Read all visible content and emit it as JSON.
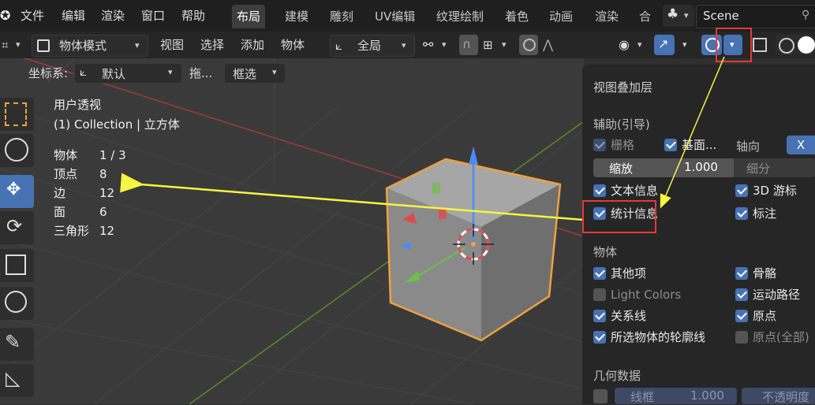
{
  "topbar": {
    "menus": [
      "文件",
      "编辑",
      "渲染",
      "窗口",
      "帮助"
    ],
    "tabs": [
      "布局",
      "建模",
      "雕刻",
      "UV编辑",
      "纹理绘制",
      "着色",
      "动画",
      "渲染",
      "合"
    ],
    "active_tab": "布局",
    "scene": "Scene"
  },
  "header": {
    "mode": "物体模式",
    "menus": [
      "视图",
      "选择",
      "添加",
      "物体"
    ],
    "transform_orientation": "全局",
    "coord_label": "坐标系:",
    "coord_value": "默认",
    "drag_label": "拖...",
    "select_mode": "框选"
  },
  "viewport": {
    "view_name": "用户透视",
    "collection": "(1) Collection | 立方体",
    "stats": [
      {
        "label": "物体",
        "value": "1 / 3"
      },
      {
        "label": "顶点",
        "value": "8"
      },
      {
        "label": "边",
        "value": "12"
      },
      {
        "label": "面",
        "value": "6"
      },
      {
        "label": "三角形",
        "value": "12"
      }
    ]
  },
  "overlay_panel": {
    "title": "视图叠加层",
    "guides_section": "辅助(引导)",
    "grid": "栅格",
    "floor": "基面...",
    "axis_label": "轴向",
    "axis_x": "X",
    "scale_label": "缩放",
    "scale_value": "1.000",
    "subdiv_label": "细分",
    "text_info": "文本信息",
    "cursor_3d": "3D 游标",
    "statistics": "统计信息",
    "annotations": "标注",
    "objects_section": "物体",
    "extras": "其他项",
    "bones": "骨骼",
    "light_colors": "Light Colors",
    "motion_paths": "运动路径",
    "relationship_lines": "关系线",
    "origins": "原点",
    "outline_selected": "所选物体的轮廓线",
    "origins_all": "原点(全部)",
    "geometry_section": "几何数据",
    "wireframe_label": "线框",
    "wireframe_value": "1.000",
    "opacity_label": "不透明度"
  },
  "colors": {
    "accent": "#4772b3",
    "annotation_arrow": "#f5f542",
    "highlight_box": "#e53935",
    "selection_outline": "#f0a040"
  }
}
